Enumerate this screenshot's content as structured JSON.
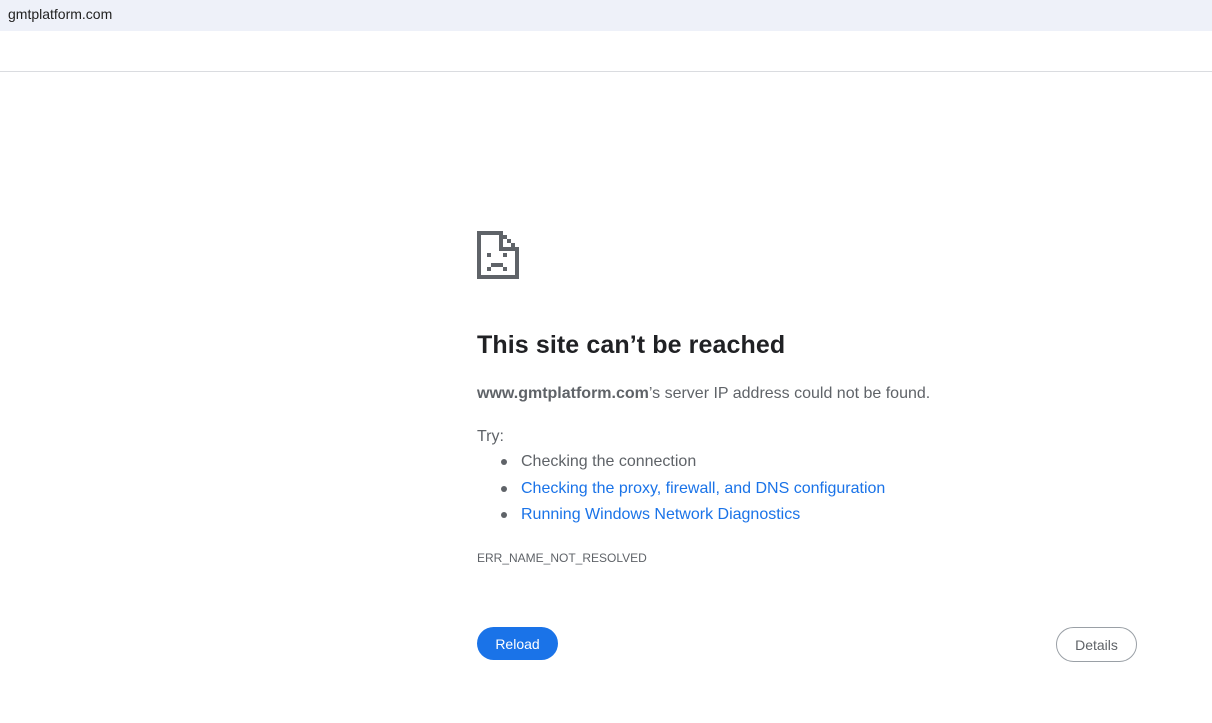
{
  "address_bar": {
    "url": "gmtplatform.com"
  },
  "error_page": {
    "icon": "sad-page-icon",
    "title": "This site can’t be reached",
    "host": "www.gmtplatform.com",
    "summary_suffix": "’s server IP address could not be found.",
    "try_label": "Try:",
    "suggestions": [
      {
        "text": "Checking the connection",
        "is_link": false
      },
      {
        "text": "Checking the proxy, firewall, and DNS configuration",
        "is_link": true
      },
      {
        "text": "Running Windows Network Diagnostics",
        "is_link": true
      }
    ],
    "error_code": "ERR_NAME_NOT_RESOLVED",
    "reload_label": "Reload",
    "details_label": "Details",
    "colors": {
      "accent": "#1a73e8",
      "text": "#5f6368",
      "title": "#202124",
      "address_bar_bg": "#eef1f9"
    }
  }
}
